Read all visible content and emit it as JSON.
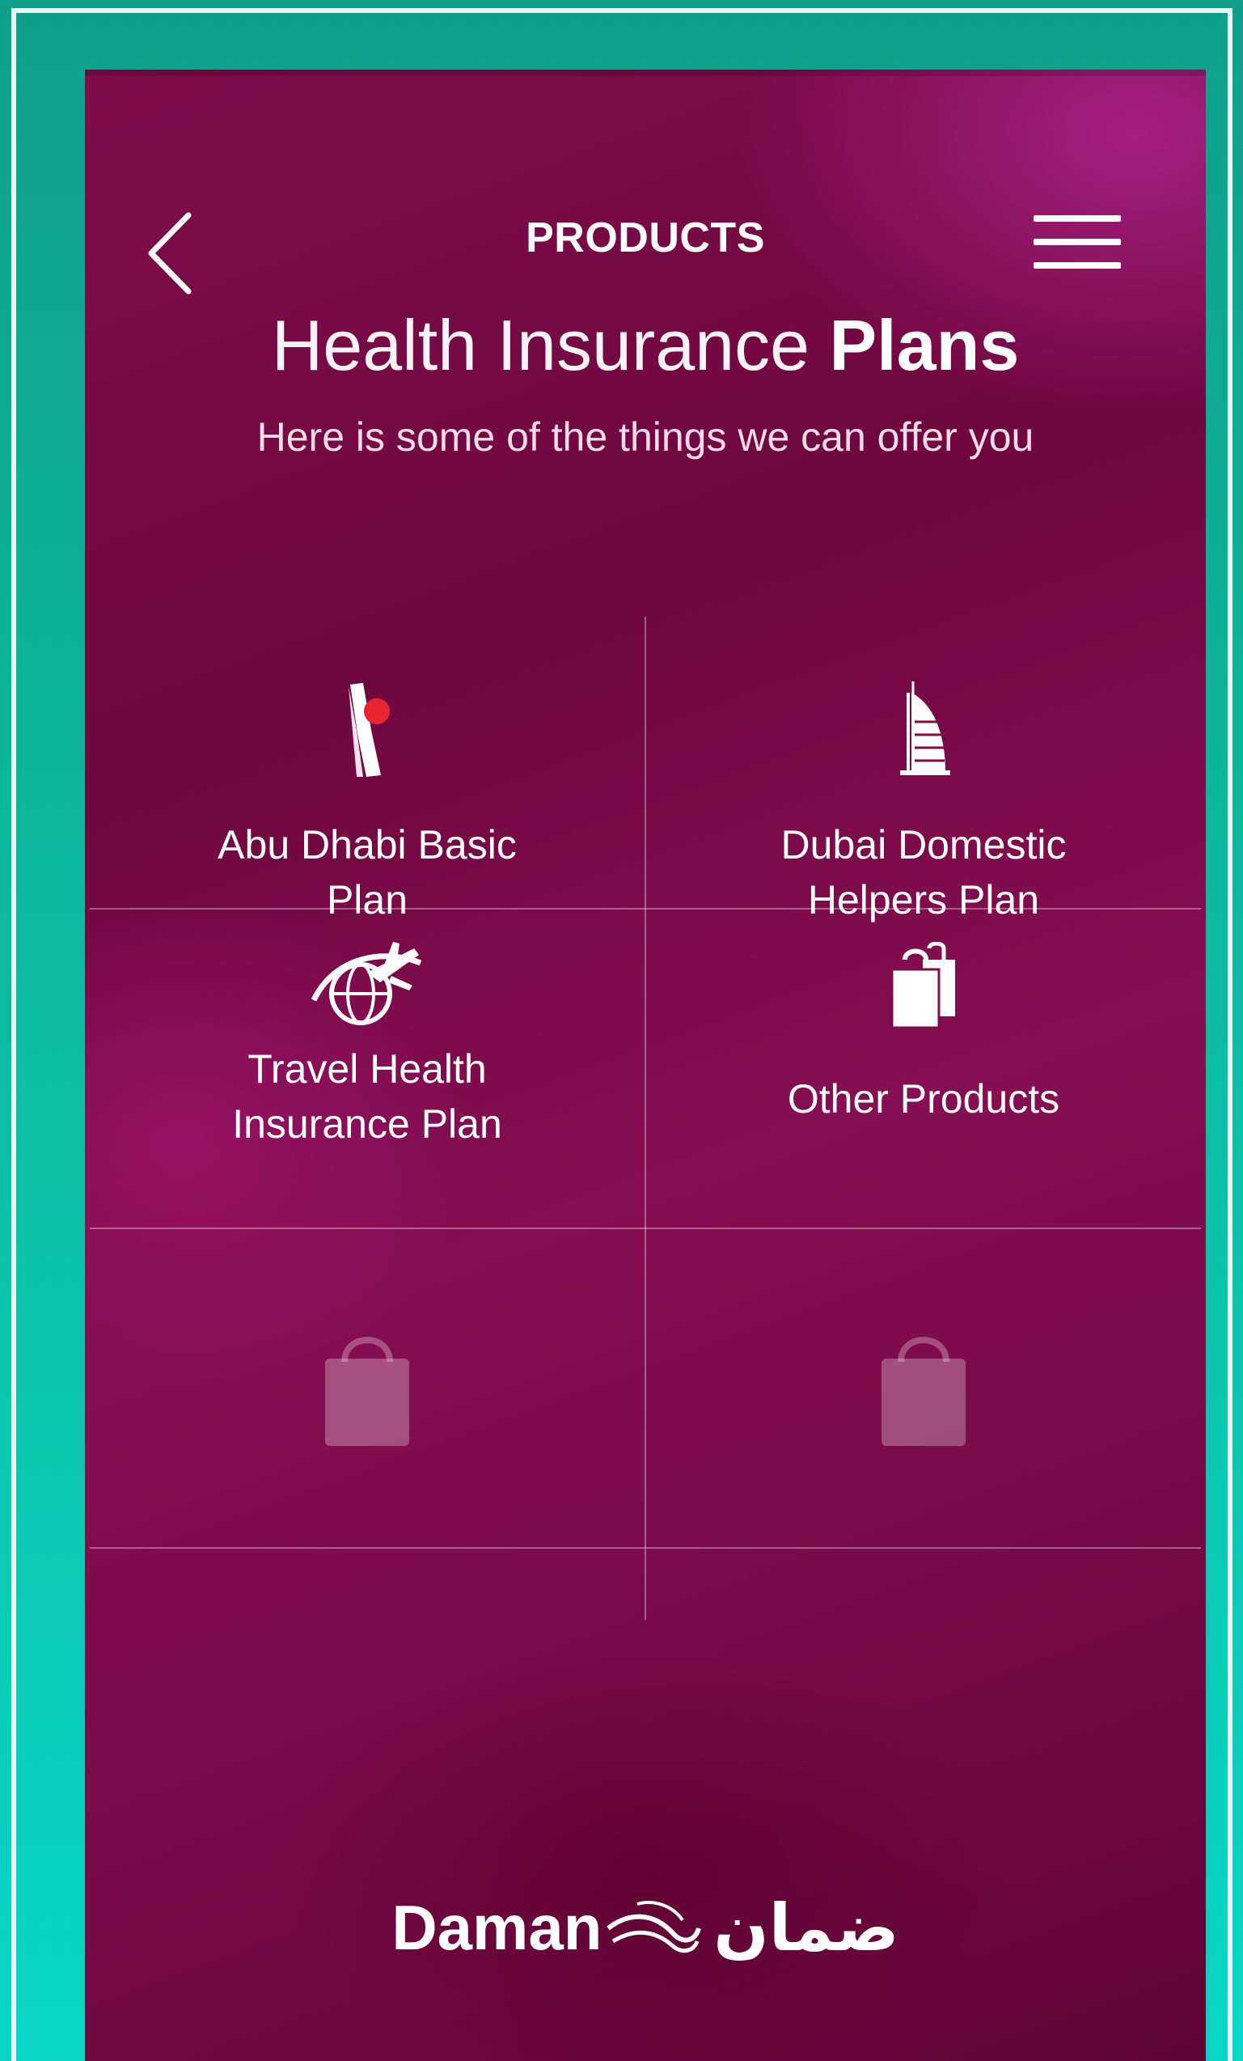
{
  "header": {
    "title": "PRODUCTS",
    "back_icon": "chevron-left-icon",
    "menu_icon": "hamburger-menu-icon"
  },
  "page": {
    "title_light": "Health Insurance",
    "title_bold": "Plans",
    "subtitle": "Here is some of the things we can offer you"
  },
  "tiles": [
    {
      "line1": "Abu Dhabi Basic",
      "line2": "Plan",
      "icon": "abu-dhabi-landmark-icon"
    },
    {
      "line1": "Dubai Domestic",
      "line2": "Helpers Plan",
      "icon": "burj-al-arab-icon"
    },
    {
      "line1": "Travel Health",
      "line2": "Insurance Plan",
      "icon": "globe-airplane-icon"
    },
    {
      "line1": "Other Products",
      "line2": "",
      "icon": "shopping-bags-icon"
    },
    {
      "line1": "",
      "line2": "",
      "icon": "locked-bag-icon"
    },
    {
      "line1": "",
      "line2": "",
      "icon": "locked-bag-icon"
    }
  ],
  "brand": {
    "name_en": "Daman",
    "name_ar": "ضمان"
  },
  "colors": {
    "background_teal": "#0cb79a",
    "panel_magenta": "#7e0d4a",
    "accent_red": "#e8252f"
  }
}
